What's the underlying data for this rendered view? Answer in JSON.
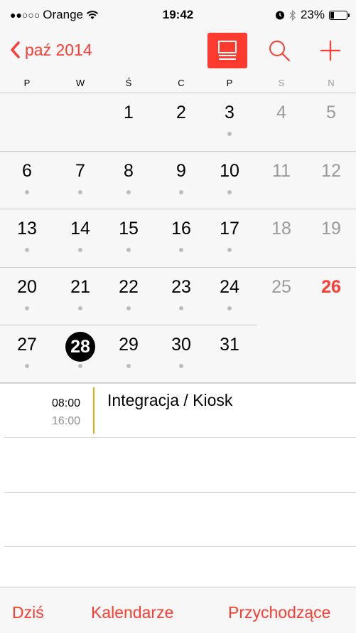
{
  "status_bar": {
    "signal_dots": "●●○○○",
    "carrier": "Orange",
    "wifi_icon": "wifi-icon",
    "time": "19:42",
    "alarm_icon": "alarm-icon",
    "bluetooth_icon": "bluetooth-icon",
    "battery": "23%",
    "battery_level": 0.23
  },
  "nav": {
    "back_label": "paź 2014",
    "list_icon": "list-view-icon",
    "search_icon": "search-icon",
    "add_icon": "plus-icon",
    "accent_color": "#ff3b30"
  },
  "weekdays": [
    "P",
    "W",
    "Ś",
    "C",
    "P",
    "S",
    "N"
  ],
  "weeks": [
    [
      "",
      "",
      "1",
      "2",
      "3",
      "4",
      "5"
    ],
    [
      "6",
      "7",
      "8",
      "9",
      "10",
      "11",
      "12"
    ],
    [
      "13",
      "14",
      "15",
      "16",
      "17",
      "18",
      "19"
    ],
    [
      "20",
      "21",
      "22",
      "23",
      "24",
      "25",
      "26"
    ],
    [
      "27",
      "28",
      "29",
      "30",
      "31",
      "",
      ""
    ]
  ],
  "selected_day": "28",
  "today_day": "26",
  "event": {
    "start": "08:00",
    "end": "16:00",
    "title": "Integracja / Kiosk",
    "color": "#f0a500"
  },
  "tabbar": {
    "today": "Dziś",
    "calendars": "Kalendarze",
    "inbox": "Przychodzące"
  }
}
